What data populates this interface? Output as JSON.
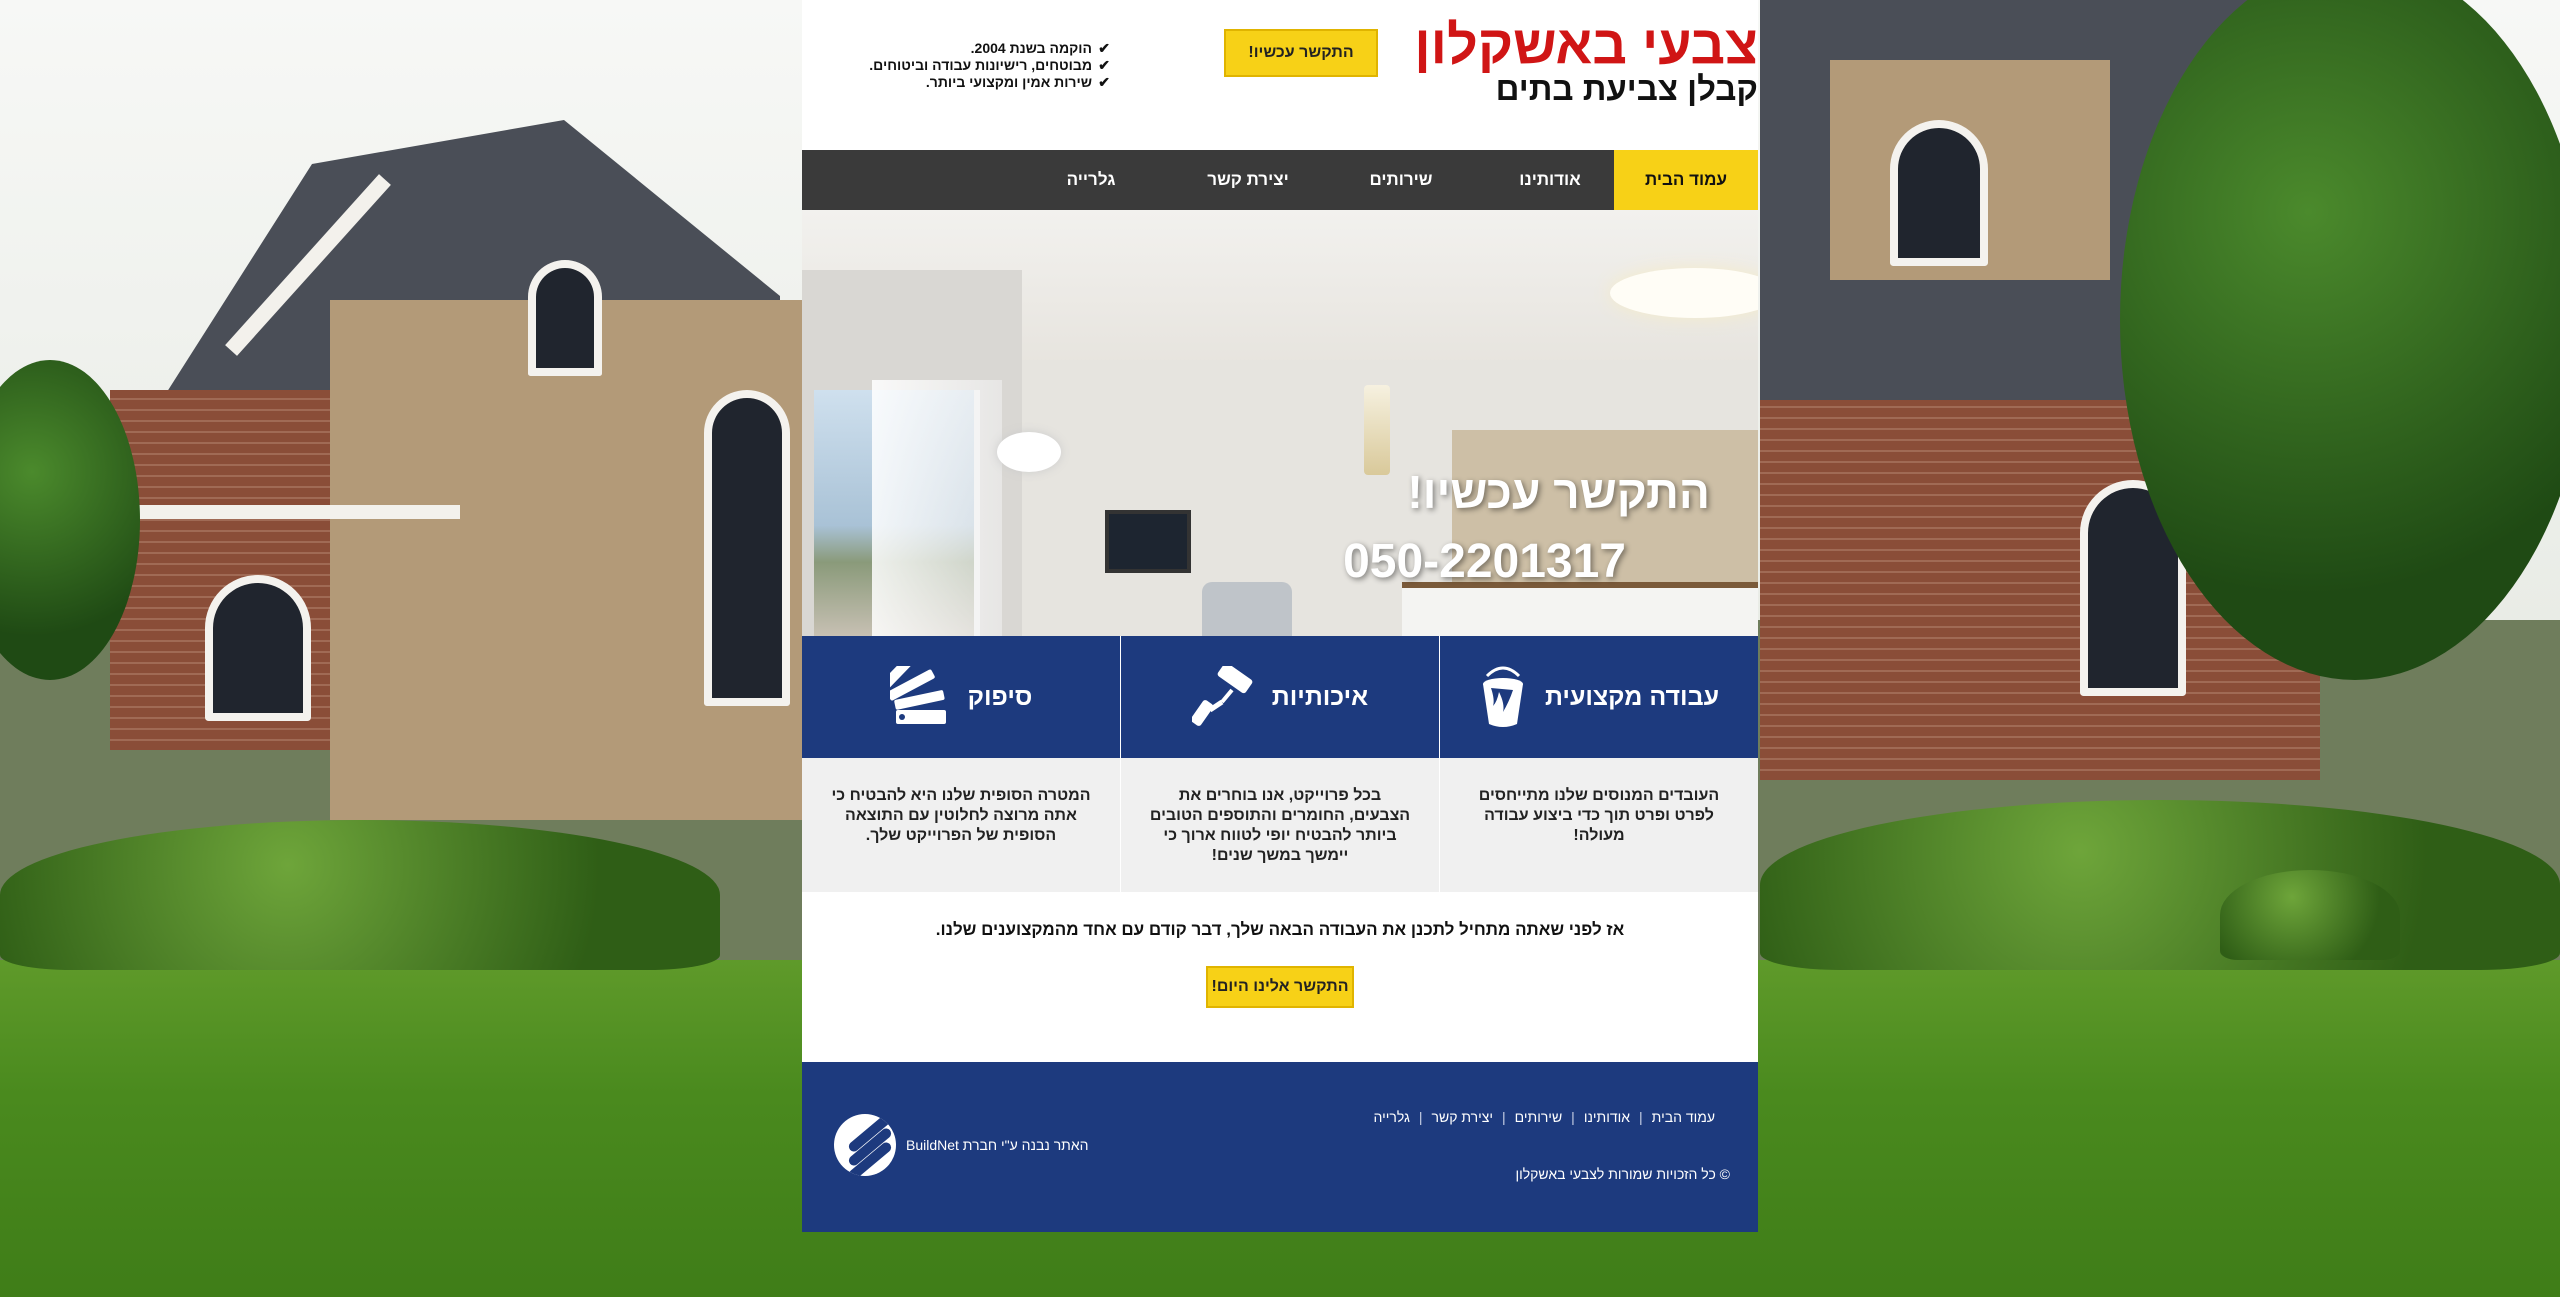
{
  "header": {
    "title": "צבעי באשקלון",
    "subtitle": "קבלן צביעת בתים",
    "cta_label": "התקשר עכשיו!",
    "features": [
      "הוקמה בשנת 2004.",
      "מבוטחים, רישיונות עבודה וביטוחים.",
      "שירות אמין ומקצועי ביותר."
    ]
  },
  "nav": {
    "items": [
      {
        "label": "עמוד הבית",
        "active": true
      },
      {
        "label": "אודותינו"
      },
      {
        "label": "שירותים"
      },
      {
        "label": "יצירת קשר"
      },
      {
        "label": "גלרייה"
      }
    ]
  },
  "hero": {
    "headline": "התקשר עכשיו!",
    "phone": "050-2201317"
  },
  "cards": [
    {
      "title": "עבודה מקצועית",
      "icon": "paint-bucket-icon",
      "text": "העובדים המנוסים שלנו מתייחסים לפרט ופרט תוך כדי ביצוע עבודה מעולה!"
    },
    {
      "title": "איכותיות",
      "icon": "paint-roller-icon",
      "text": "בכל פרוייקט, אנו בוחרים את הצבעים, החומרים והתוספים הטובים ביותר להבטיח יופי לטווח ארוך כי יימשך במשך שנים!"
    },
    {
      "title": "סיפוק",
      "icon": "color-swatch-icon",
      "text": "המטרה הסופית שלנו היא להבטיח כי אתה מרוצה לחלוטין עם התוצאה הסופית של הפרוייקט שלך."
    }
  ],
  "cta_strip": {
    "text": "אז לפני שאתה מתחיל לתכנן את העבודה הבאה שלך, דבר קודם עם אחד מהמקצוענים שלנו.",
    "button": "התקשר אלינו היום!"
  },
  "footer": {
    "links": [
      "עמוד הבית",
      "אודותינו",
      "שירותים",
      "יצירת קשר",
      "גלרייה"
    ],
    "copyright": "© כל הזכויות שמורות לצבעי באשקלון",
    "credit": "האתר נבנה ע\"י חברת BuildNet"
  },
  "colors": {
    "accent_yellow": "#f7d117",
    "navy": "#1d3a7e",
    "title_red": "#d01515",
    "nav_dark": "#3a3a3a"
  }
}
